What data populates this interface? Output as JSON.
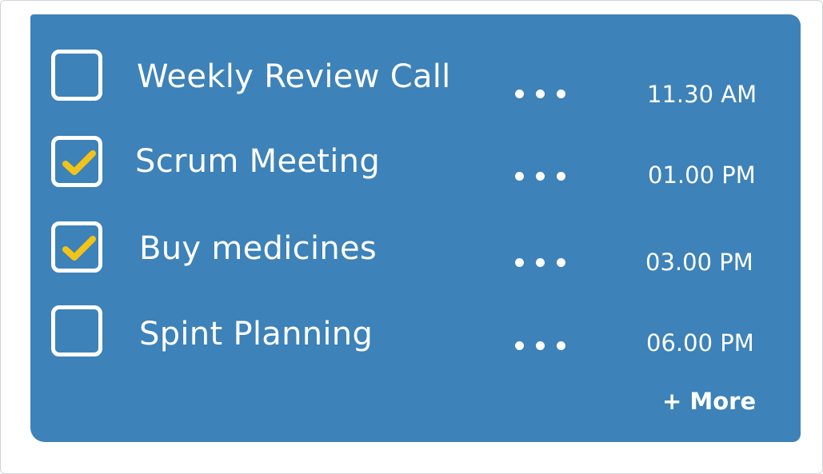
{
  "tasks": [
    {
      "label": "Weekly Review Call",
      "time": "11.30 AM",
      "checked": false
    },
    {
      "label": "Scrum Meeting",
      "time": "01.00 PM",
      "checked": true
    },
    {
      "label": "Buy medicines",
      "time": "03.00 PM",
      "checked": true
    },
    {
      "label": "Spint Planning",
      "time": "06.00 PM",
      "checked": false
    }
  ],
  "footer": {
    "more_label": "+ More"
  },
  "colors": {
    "card_background": "#3d82b8",
    "text": "#ffffff",
    "checkmark": "#f2c318"
  },
  "icons": {
    "checkbox_check": "check-icon",
    "task_options": "ellipsis-icon"
  }
}
